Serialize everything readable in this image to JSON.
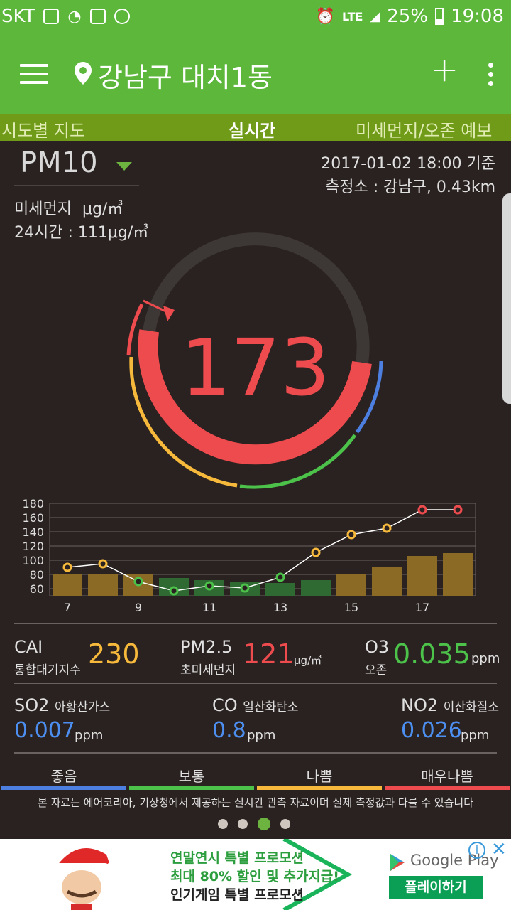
{
  "status": {
    "carrier": "SKT",
    "network": "LTE",
    "battery": "25%",
    "time": "19:08"
  },
  "appbar": {
    "location": "강남구 대치1동"
  },
  "tabs": [
    "시도별 지도",
    "실시간",
    "미세먼지/오존 예보"
  ],
  "pm": {
    "selector": "PM10",
    "name": "미세먼지",
    "unit": "μg/㎥",
    "avg24_label": "24시간 :",
    "avg24_value": "111μg/㎥",
    "datetime": "2017-01-02   18:00 기준",
    "station": "측정소 : 강남구, 0.43km",
    "current": "173"
  },
  "colors": {
    "good": "#4c7fe0",
    "normal": "#4cc24a",
    "bad": "#f6b93b",
    "very_bad": "#ee4b4f"
  },
  "chart_data": {
    "type": "bar",
    "x": [
      7,
      8,
      9,
      10,
      11,
      12,
      13,
      14,
      15,
      16,
      17,
      18
    ],
    "xticks": [
      "7",
      "9",
      "11",
      "13",
      "15",
      "17"
    ],
    "ylim": [
      50,
      180
    ],
    "yticks": [
      "180",
      "160",
      "140",
      "120",
      "100",
      "80",
      "60"
    ],
    "series": [
      {
        "type": "bar",
        "values": [
          80,
          80,
          80,
          75,
          72,
          70,
          68,
          72,
          80,
          90,
          106,
          110
        ],
        "colors": [
          "#8a6a25",
          "#8a6a25",
          "#8a6a25",
          "#2f6a32",
          "#2f6a32",
          "#2f6a32",
          "#2f6a32",
          "#2f6a32",
          "#8a6a25",
          "#8a6a25",
          "#8a6a25",
          "#8a6a25"
        ]
      },
      {
        "type": "line",
        "values": [
          90,
          95,
          70,
          57,
          64,
          61,
          76,
          111,
          136,
          145,
          171,
          171
        ],
        "colors": [
          "#f6b93b",
          "#f6b93b",
          "#4cc24a",
          "#4cc24a",
          "#4cc24a",
          "#4cc24a",
          "#4cc24a",
          "#f6b93b",
          "#f6b93b",
          "#f6b93b",
          "#ee4b4f",
          "#ee4b4f"
        ]
      }
    ]
  },
  "metrics": {
    "cai": {
      "title": "CAI",
      "sub": "통합대기지수",
      "value": "230"
    },
    "pm25": {
      "title": "PM2.5",
      "sub": "초미세먼지",
      "value": "121",
      "unit": "μg/㎥"
    },
    "o3": {
      "title": "O3",
      "sub": "오존",
      "value": "0.035",
      "unit": "ppm"
    },
    "so2": {
      "title": "SO2",
      "sub": "아황산가스",
      "value": "0.007",
      "unit": "ppm"
    },
    "co": {
      "title": "CO",
      "sub": "일산화탄소",
      "value": "0.8",
      "unit": "ppm"
    },
    "no2": {
      "title": "NO2",
      "sub": "이산화질소",
      "value": "0.026",
      "unit": "ppm"
    }
  },
  "legend": [
    "좋음",
    "보통",
    "나쁨",
    "매우나쁨"
  ],
  "notice": "본 자료는 에어코리아, 기상청에서 제공하는 실시간 관측 자료이며 실제 측정값과 다를 수 있습니다",
  "ad": {
    "line1": "연말연시 특별 프로모션",
    "line2": "최대 80% 할인 및 추가지급!",
    "line3": "인기게임 특별 프로모션",
    "store": "Google Play",
    "button": "플레이하기"
  }
}
